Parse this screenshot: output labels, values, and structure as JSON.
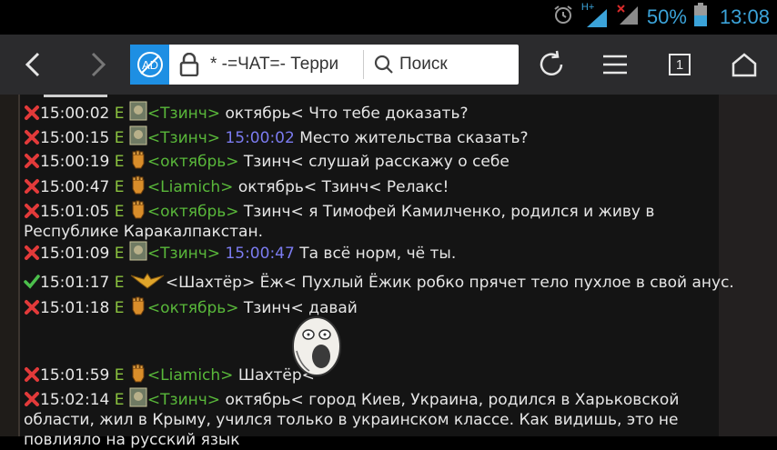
{
  "status_bar": {
    "network": "H+",
    "battery_percent": "50%",
    "time": "13:08"
  },
  "toolbar": {
    "ad_label": "AD",
    "url_text": "* -=ЧАТ=- Терри",
    "search_label": "Поиск",
    "tabs_count": "1"
  },
  "messages": [
    {
      "status": "x",
      "time": "15:00:02",
      "e": "E",
      "avatar": "shield",
      "sender": "<Тзинч>",
      "text": " октябрь< Что тебе доказать?"
    },
    {
      "status": "x",
      "time": "15:00:15",
      "e": "E",
      "avatar": "shield",
      "sender": "<Тзинч>",
      "ref": " 15:00:02",
      "text": " Место жительства сказать?"
    },
    {
      "status": "x",
      "time": "15:00:19",
      "e": "E",
      "avatar": "fist",
      "sender": "<октябрь>",
      "text": " Тзинч< слушай расскажу о себе"
    },
    {
      "status": "x",
      "time": "15:00:47",
      "e": "E",
      "avatar": "fist",
      "sender": "<Liamich>",
      "text": " октябрь< Тзинч< Релакс!"
    },
    {
      "status": "x",
      "time": "15:01:05",
      "e": "E",
      "avatar": "fist",
      "sender": "<октябрь>",
      "text": " Тзинч< я Тимофей Камилченко, родился и живу в Республике Каракалпакстан."
    },
    {
      "status": "x",
      "time": "15:01:09",
      "e": "E",
      "avatar": "shield",
      "sender": "<Тзинч>",
      "ref": " 15:00:47",
      "text": " Та всё норм, чё ты."
    },
    {
      "status": "check",
      "time": "15:01:17",
      "e": "E",
      "avatar": "eagle",
      "sender": "",
      "text": "<Шахтёр> Ёж< Пухлый Ёжик робко прячет тело пухлое в свой анус."
    },
    {
      "status": "x",
      "time": "15:01:18",
      "e": "E",
      "avatar": "fist",
      "sender": "<октябрь>",
      "text": " Тзинч< давай"
    },
    {
      "status": "x",
      "time": "15:01:59",
      "e": "E",
      "avatar": "fist",
      "sender": "<Liamich>",
      "text": " Шахтёр<"
    },
    {
      "status": "x",
      "time": "15:02:14",
      "e": "E",
      "avatar": "shield",
      "sender": "<Тзинч>",
      "text": " октябрь< город Киев, Украина, родился в Харьковской области, жил в Крыму, учился только в украинском классе. Как видишь, это не повлияло на русский язык"
    }
  ]
}
